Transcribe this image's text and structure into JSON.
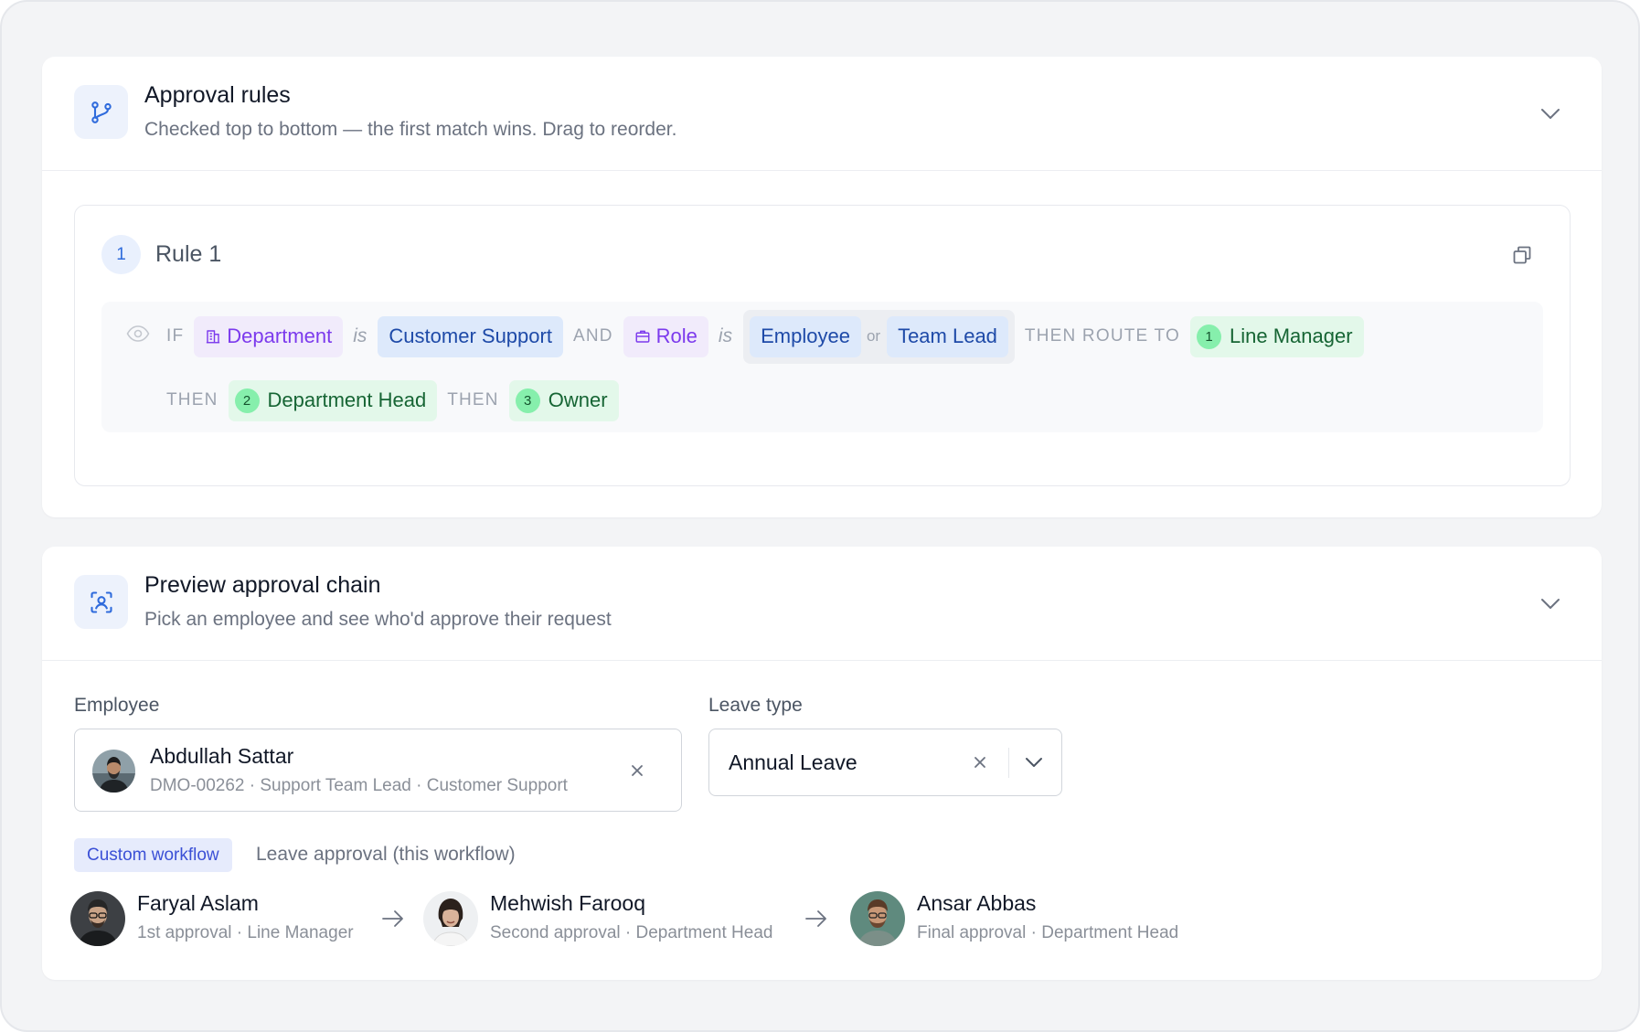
{
  "colors": {
    "accent_blue": "#2f6bdc",
    "attribute_chip": "#7c3aed",
    "value_chip": "#1e4aa8",
    "step_chip": "#166534",
    "badge": "#3b50d6"
  },
  "approval_rules": {
    "icon": "git-branch-icon",
    "title": "Approval rules",
    "subtitle": "Checked top to bottom — the first match wins. Drag to reorder.",
    "rule": {
      "number": "1",
      "name": "Rule 1",
      "if_kw": "IF",
      "cond1_attr": "Department",
      "cond1_attr_icon": "building-icon",
      "is_kw": "is",
      "cond1_value": "Customer Support",
      "and_kw": "AND",
      "cond2_attr": "Role",
      "cond2_attr_icon": "briefcase-icon",
      "cond2_values": [
        "Employee",
        "Team Lead"
      ],
      "or_kw": "or",
      "route_kw": "THEN ROUTE TO",
      "then_kw": "THEN",
      "steps": [
        {
          "num": "1",
          "label": "Line Manager"
        },
        {
          "num": "2",
          "label": "Department Head"
        },
        {
          "num": "3",
          "label": "Owner"
        }
      ]
    }
  },
  "preview": {
    "icon": "scan-user-icon",
    "title": "Preview approval chain",
    "subtitle": "Pick an employee and see who'd approve their request",
    "employee_label": "Employee",
    "employee": {
      "name": "Abdullah Sattar",
      "meta": "DMO-00262 · Support Team Lead · Customer Support"
    },
    "leave_label": "Leave type",
    "leave_value": "Annual Leave",
    "badge": "Custom workflow",
    "badge_desc": "Leave approval (this workflow)",
    "chain": [
      {
        "name": "Faryal Aslam",
        "role": "1st approval · Line Manager"
      },
      {
        "name": "Mehwish Farooq",
        "role": "Second approval · Department Head"
      },
      {
        "name": "Ansar Abbas",
        "role": "Final approval · Department Head"
      }
    ]
  }
}
